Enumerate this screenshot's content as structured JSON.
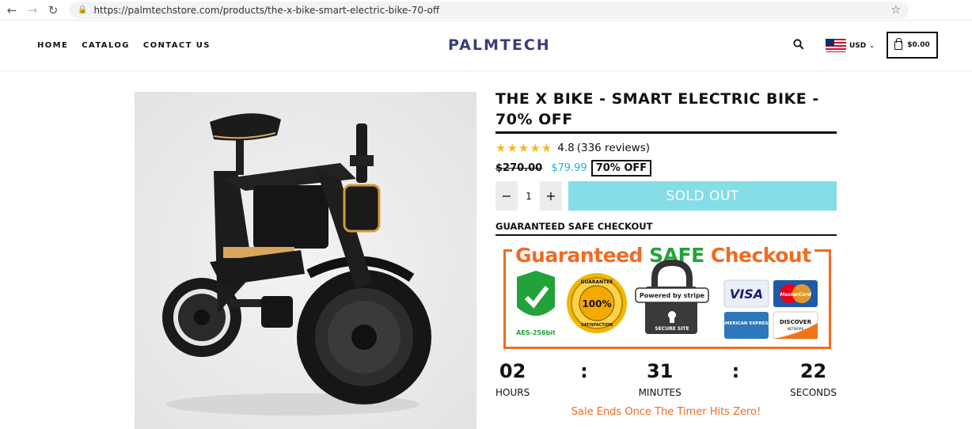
{
  "browser": {
    "back_icon": "back-arrow-icon",
    "url": "https://palmtechstore.com/products/the-x-bike-smart-electric-bike-70-off"
  },
  "header": {
    "nav": [
      "HOME",
      "CATALOG",
      "CONTACT US"
    ],
    "logo": "PALMTECH",
    "currency": "USD",
    "cart_total": "$0.00"
  },
  "product": {
    "title": "THE X BIKE - SMART ELECTRIC BIKE - 70% OFF",
    "rating": "4.8",
    "reviews": "(336 reviews)",
    "old_price": "$270.00",
    "new_price": "$79.99",
    "discount": "70% OFF",
    "quantity": "1",
    "buy_button": "SOLD OUT",
    "guarantee_label": "GUARANTEED SAFE CHECKOUT"
  },
  "badge": {
    "title_part1": "Guaranteed ",
    "title_part2": "SAFE",
    "title_part3": " Checkout",
    "aes": "AES-256bit",
    "guarantee_top": "GUARANTEE",
    "guarantee_pct": "100%",
    "guarantee_bottom": "SATISFACTION",
    "stripe": "Powered by stripe",
    "secure": "SECURE SITE",
    "visa": "VISA",
    "mastercard": "MasterCard",
    "amex": "AMERICAN EXPRESS",
    "discover": "DISCOVER",
    "discover_sub": "NETWORK"
  },
  "timer": {
    "hours": "02",
    "minutes": "31",
    "seconds": "22",
    "hours_label": "HOURS",
    "minutes_label": "MINUTES",
    "seconds_label": "SECONDS",
    "separator": ":"
  },
  "sale_note": "Sale Ends Once The Timer Hits Zero!",
  "colors": {
    "accent": "#1fb7c6",
    "soldout_bg": "#84dde7",
    "orange": "#f26a21",
    "green": "#23a23a",
    "logo": "#3a3b7a",
    "star": "#f7b918"
  }
}
